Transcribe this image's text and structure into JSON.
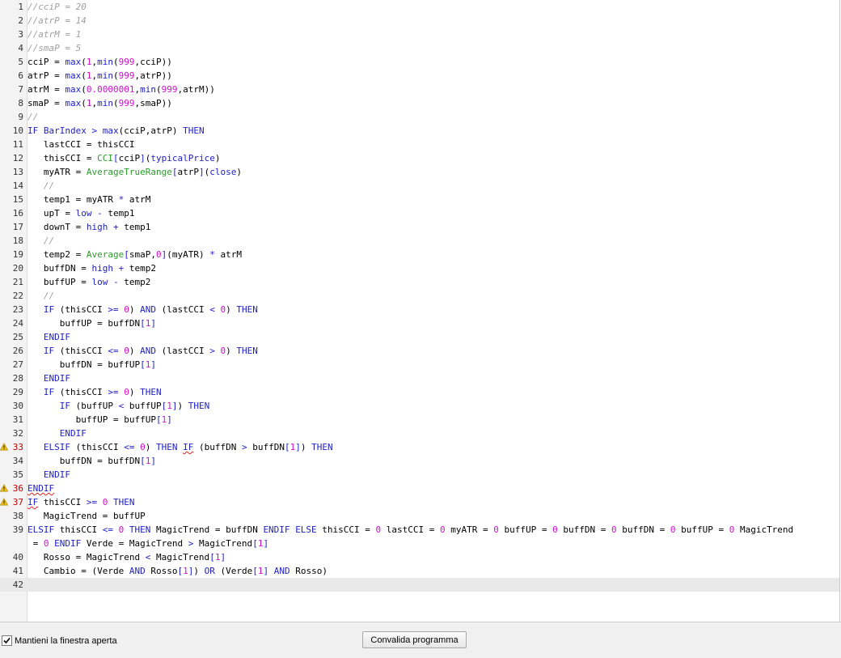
{
  "editor": {
    "current_line": 42,
    "lines": [
      {
        "n": "1",
        "tokens": [
          [
            "cm",
            "//cciP = 20"
          ]
        ]
      },
      {
        "n": "2",
        "tokens": [
          [
            "cm",
            "//atrP = 14"
          ]
        ]
      },
      {
        "n": "3",
        "tokens": [
          [
            "cm",
            "//atrM = 1"
          ]
        ]
      },
      {
        "n": "4",
        "tokens": [
          [
            "cm",
            "//smaP = 5"
          ]
        ]
      },
      {
        "n": "5",
        "tokens": [
          [
            "",
            "cciP = "
          ],
          [
            "kw",
            "max"
          ],
          [
            "",
            "("
          ],
          [
            "num",
            "1"
          ],
          [
            "",
            ","
          ],
          [
            "kw",
            "min"
          ],
          [
            "",
            "("
          ],
          [
            "num",
            "999"
          ],
          [
            "",
            ",cciP))"
          ]
        ]
      },
      {
        "n": "6",
        "tokens": [
          [
            "",
            "atrP = "
          ],
          [
            "kw",
            "max"
          ],
          [
            "",
            "("
          ],
          [
            "num",
            "1"
          ],
          [
            "",
            ","
          ],
          [
            "kw",
            "min"
          ],
          [
            "",
            "("
          ],
          [
            "num",
            "999"
          ],
          [
            "",
            ",atrP))"
          ]
        ]
      },
      {
        "n": "7",
        "tokens": [
          [
            "",
            "atrM = "
          ],
          [
            "kw",
            "max"
          ],
          [
            "",
            "("
          ],
          [
            "num",
            "0.0000001"
          ],
          [
            "",
            ","
          ],
          [
            "kw",
            "min"
          ],
          [
            "",
            "("
          ],
          [
            "num",
            "999"
          ],
          [
            "",
            ",atrM))"
          ]
        ]
      },
      {
        "n": "8",
        "tokens": [
          [
            "",
            "smaP = "
          ],
          [
            "kw",
            "max"
          ],
          [
            "",
            "("
          ],
          [
            "num",
            "1"
          ],
          [
            "",
            ","
          ],
          [
            "kw",
            "min"
          ],
          [
            "",
            "("
          ],
          [
            "num",
            "999"
          ],
          [
            "",
            ",smaP))"
          ]
        ]
      },
      {
        "n": "9",
        "tokens": [
          [
            "cm",
            "//"
          ]
        ]
      },
      {
        "n": "10",
        "tokens": [
          [
            "kw",
            "IF"
          ],
          [
            "",
            " "
          ],
          [
            "kw",
            "BarIndex"
          ],
          [
            "",
            " "
          ],
          [
            "kw",
            ">"
          ],
          [
            "",
            " "
          ],
          [
            "kw",
            "max"
          ],
          [
            "",
            "(cciP,atrP) "
          ],
          [
            "kw",
            "THEN"
          ]
        ]
      },
      {
        "n": "11",
        "tokens": [
          [
            "",
            "   lastCCI = thisCCI"
          ]
        ]
      },
      {
        "n": "12",
        "tokens": [
          [
            "",
            "   thisCCI = "
          ],
          [
            "fn",
            "CCI"
          ],
          [
            "kw",
            "["
          ],
          [
            "",
            "cciP"
          ],
          [
            "kw",
            "]"
          ],
          [
            "",
            "("
          ],
          [
            "kw",
            "typicalPrice"
          ],
          [
            "",
            ")"
          ]
        ]
      },
      {
        "n": "13",
        "tokens": [
          [
            "",
            "   myATR = "
          ],
          [
            "fn",
            "AverageTrueRange"
          ],
          [
            "kw",
            "["
          ],
          [
            "",
            "atrP"
          ],
          [
            "kw",
            "]"
          ],
          [
            "",
            "("
          ],
          [
            "kw",
            "close"
          ],
          [
            "",
            ")"
          ]
        ]
      },
      {
        "n": "14",
        "tokens": [
          [
            "cm",
            "   //"
          ]
        ]
      },
      {
        "n": "15",
        "tokens": [
          [
            "",
            "   temp1 = myATR "
          ],
          [
            "kw",
            "*"
          ],
          [
            "",
            ""
          ],
          [
            "",
            " atrM"
          ]
        ]
      },
      {
        "n": "16",
        "tokens": [
          [
            "",
            "   upT = "
          ],
          [
            "kw",
            "low"
          ],
          [
            "",
            " "
          ],
          [
            "kw",
            "-"
          ],
          [
            "",
            ""
          ],
          [
            "",
            " temp1"
          ]
        ]
      },
      {
        "n": "17",
        "tokens": [
          [
            "",
            "   downT = "
          ],
          [
            "kw",
            "high"
          ],
          [
            "",
            " "
          ],
          [
            "kw",
            "+"
          ],
          [
            "",
            ""
          ],
          [
            "",
            " temp1"
          ]
        ]
      },
      {
        "n": "18",
        "tokens": [
          [
            "cm",
            "   //"
          ]
        ]
      },
      {
        "n": "19",
        "tokens": [
          [
            "",
            "   temp2 = "
          ],
          [
            "fn",
            "Average"
          ],
          [
            "kw",
            "["
          ],
          [
            "",
            "smaP,"
          ],
          [
            "num",
            "0"
          ],
          [
            "kw",
            "]"
          ],
          [
            "",
            "(myATR) "
          ],
          [
            "kw",
            "*"
          ],
          [
            "",
            " atrM"
          ]
        ]
      },
      {
        "n": "20",
        "tokens": [
          [
            "",
            "   buffDN = "
          ],
          [
            "kw",
            "high"
          ],
          [
            "",
            " "
          ],
          [
            "kw",
            "+"
          ],
          [
            "",
            " temp2"
          ]
        ]
      },
      {
        "n": "21",
        "tokens": [
          [
            "",
            "   buffUP = "
          ],
          [
            "kw",
            "low"
          ],
          [
            "",
            " "
          ],
          [
            "kw",
            "-"
          ],
          [
            "",
            " temp2"
          ]
        ]
      },
      {
        "n": "22",
        "tokens": [
          [
            "cm",
            "   //"
          ]
        ]
      },
      {
        "n": "23",
        "tokens": [
          [
            "",
            "   "
          ],
          [
            "kw",
            "IF"
          ],
          [
            "",
            " (thisCCI "
          ],
          [
            "kw",
            ">="
          ],
          [
            "",
            " "
          ],
          [
            "num",
            "0"
          ],
          [
            "",
            ") "
          ],
          [
            "kw",
            "AND"
          ],
          [
            "",
            " (lastCCI "
          ],
          [
            "kw",
            "<"
          ],
          [
            "",
            " "
          ],
          [
            "num",
            "0"
          ],
          [
            "",
            ") "
          ],
          [
            "kw",
            "THEN"
          ]
        ]
      },
      {
        "n": "24",
        "tokens": [
          [
            "",
            "      buffUP = buffDN"
          ],
          [
            "kw",
            "["
          ],
          [
            "num",
            "1"
          ],
          [
            "kw",
            "]"
          ]
        ]
      },
      {
        "n": "25",
        "tokens": [
          [
            "",
            "   "
          ],
          [
            "kw",
            "ENDIF"
          ]
        ]
      },
      {
        "n": "26",
        "tokens": [
          [
            "",
            "   "
          ],
          [
            "kw",
            "IF"
          ],
          [
            "",
            " (thisCCI "
          ],
          [
            "kw",
            "<="
          ],
          [
            "",
            " "
          ],
          [
            "num",
            "0"
          ],
          [
            "",
            ") "
          ],
          [
            "kw",
            "AND"
          ],
          [
            "",
            " (lastCCI "
          ],
          [
            "kw",
            ">"
          ],
          [
            "",
            " "
          ],
          [
            "num",
            "0"
          ],
          [
            "",
            ") "
          ],
          [
            "kw",
            "THEN"
          ]
        ]
      },
      {
        "n": "27",
        "tokens": [
          [
            "",
            "      buffDN = buffUP"
          ],
          [
            "kw",
            "["
          ],
          [
            "num",
            "1"
          ],
          [
            "kw",
            "]"
          ]
        ]
      },
      {
        "n": "28",
        "tokens": [
          [
            "",
            "   "
          ],
          [
            "kw",
            "ENDIF"
          ]
        ]
      },
      {
        "n": "29",
        "tokens": [
          [
            "",
            "   "
          ],
          [
            "kw",
            "IF"
          ],
          [
            "",
            " (thisCCI "
          ],
          [
            "kw",
            ">="
          ],
          [
            "",
            " "
          ],
          [
            "num",
            "0"
          ],
          [
            "",
            ") "
          ],
          [
            "kw",
            "THEN"
          ]
        ]
      },
      {
        "n": "30",
        "tokens": [
          [
            "",
            "      "
          ],
          [
            "kw",
            "IF"
          ],
          [
            "",
            " (buffUP "
          ],
          [
            "kw",
            "<"
          ],
          [
            "",
            " buffUP"
          ],
          [
            "kw",
            "["
          ],
          [
            "num",
            "1"
          ],
          [
            "kw",
            "]"
          ],
          [
            "",
            ") "
          ],
          [
            "kw",
            "THEN"
          ]
        ]
      },
      {
        "n": "31",
        "tokens": [
          [
            "",
            "         buffUP = buffUP"
          ],
          [
            "kw",
            "["
          ],
          [
            "num",
            "1"
          ],
          [
            "kw",
            "]"
          ]
        ]
      },
      {
        "n": "32",
        "tokens": [
          [
            "",
            "      "
          ],
          [
            "kw",
            "ENDIF"
          ]
        ]
      },
      {
        "n": "33",
        "warn": true,
        "tokens": [
          [
            "",
            "   "
          ],
          [
            "kw",
            "ELSIF"
          ],
          [
            "",
            " (thisCCI "
          ],
          [
            "kw",
            "<="
          ],
          [
            "",
            " "
          ],
          [
            "num",
            "0"
          ],
          [
            "",
            ") "
          ],
          [
            "kw",
            "THEN"
          ],
          [
            "",
            " "
          ],
          [
            "kw squig",
            "IF"
          ],
          [
            "",
            " (buffDN "
          ],
          [
            "kw",
            ">"
          ],
          [
            "",
            " buffDN"
          ],
          [
            "kw",
            "["
          ],
          [
            "num",
            "1"
          ],
          [
            "kw",
            "]"
          ],
          [
            "",
            ") "
          ],
          [
            "kw",
            "THEN"
          ]
        ]
      },
      {
        "n": "34",
        "tokens": [
          [
            "",
            "      buffDN = buffDN"
          ],
          [
            "kw",
            "["
          ],
          [
            "num",
            "1"
          ],
          [
            "kw",
            "]"
          ]
        ]
      },
      {
        "n": "35",
        "tokens": [
          [
            "",
            "   "
          ],
          [
            "kw",
            "ENDIF"
          ]
        ]
      },
      {
        "n": "36",
        "warn": true,
        "tokens": [
          [
            "kw squig",
            "ENDIF"
          ]
        ]
      },
      {
        "n": "37",
        "warn": true,
        "tokens": [
          [
            "kw squig",
            "IF"
          ],
          [
            "",
            " thisCCI "
          ],
          [
            "kw",
            ">="
          ],
          [
            "",
            " "
          ],
          [
            "num",
            "0"
          ],
          [
            "",
            " "
          ],
          [
            "kw",
            "THEN"
          ]
        ]
      },
      {
        "n": "38",
        "tokens": [
          [
            "",
            "   MagicTrend = buffUP"
          ]
        ]
      },
      {
        "n": "39",
        "tokens": [
          [
            "kw",
            "ELSIF"
          ],
          [
            "",
            " thisCCI "
          ],
          [
            "kw",
            "<="
          ],
          [
            "",
            " "
          ],
          [
            "num",
            "0"
          ],
          [
            "",
            " "
          ],
          [
            "kw",
            "THEN"
          ],
          [
            "",
            " MagicTrend = buffDN "
          ],
          [
            "kw",
            "ENDIF"
          ],
          [
            "",
            " "
          ],
          [
            "kw",
            "ELSE"
          ],
          [
            "",
            " thisCCI = "
          ],
          [
            "num",
            "0"
          ],
          [
            "",
            " lastCCI = "
          ],
          [
            "num",
            "0"
          ],
          [
            "",
            " myATR = "
          ],
          [
            "num",
            "0"
          ],
          [
            "",
            " buffUP = "
          ],
          [
            "num",
            "0"
          ],
          [
            "",
            " buffDN = "
          ],
          [
            "num",
            "0"
          ],
          [
            "",
            " buffDN = "
          ],
          [
            "num",
            "0"
          ],
          [
            "",
            " buffUP = "
          ],
          [
            "num",
            "0"
          ],
          [
            "",
            " MagicTrend"
          ]
        ]
      },
      {
        "n": "",
        "tokens": [
          [
            "",
            " = "
          ],
          [
            "num",
            "0"
          ],
          [
            "",
            " "
          ],
          [
            "kw",
            "ENDIF"
          ],
          [
            "",
            " Verde = MagicTrend "
          ],
          [
            "kw",
            ">"
          ],
          [
            "",
            " MagicTrend"
          ],
          [
            "kw",
            "["
          ],
          [
            "num",
            "1"
          ],
          [
            "kw",
            "]"
          ]
        ]
      },
      {
        "n": "40",
        "tokens": [
          [
            "",
            "   Rosso = MagicTrend "
          ],
          [
            "kw",
            "<"
          ],
          [
            "",
            " MagicTrend"
          ],
          [
            "kw",
            "["
          ],
          [
            "num",
            "1"
          ],
          [
            "kw",
            "]"
          ]
        ]
      },
      {
        "n": "41",
        "tokens": [
          [
            "",
            "   Cambio = (Verde "
          ],
          [
            "kw",
            "AND"
          ],
          [
            "",
            " Rosso"
          ],
          [
            "kw",
            "["
          ],
          [
            "num",
            "1"
          ],
          [
            "kw",
            "]"
          ],
          [
            "",
            ") "
          ],
          [
            "kw",
            "OR"
          ],
          [
            "",
            " (Verde"
          ],
          [
            "kw",
            "["
          ],
          [
            "num",
            "1"
          ],
          [
            "kw",
            "]"
          ],
          [
            "",
            " "
          ],
          [
            "kw",
            "AND"
          ],
          [
            "",
            " Rosso)"
          ]
        ]
      },
      {
        "n": "42",
        "current": true,
        "tokens": []
      }
    ]
  },
  "footer": {
    "keep_open_label": "Mantieni la finestra aperta",
    "keep_open_checked": true,
    "validate_label": "Convalida programma"
  }
}
